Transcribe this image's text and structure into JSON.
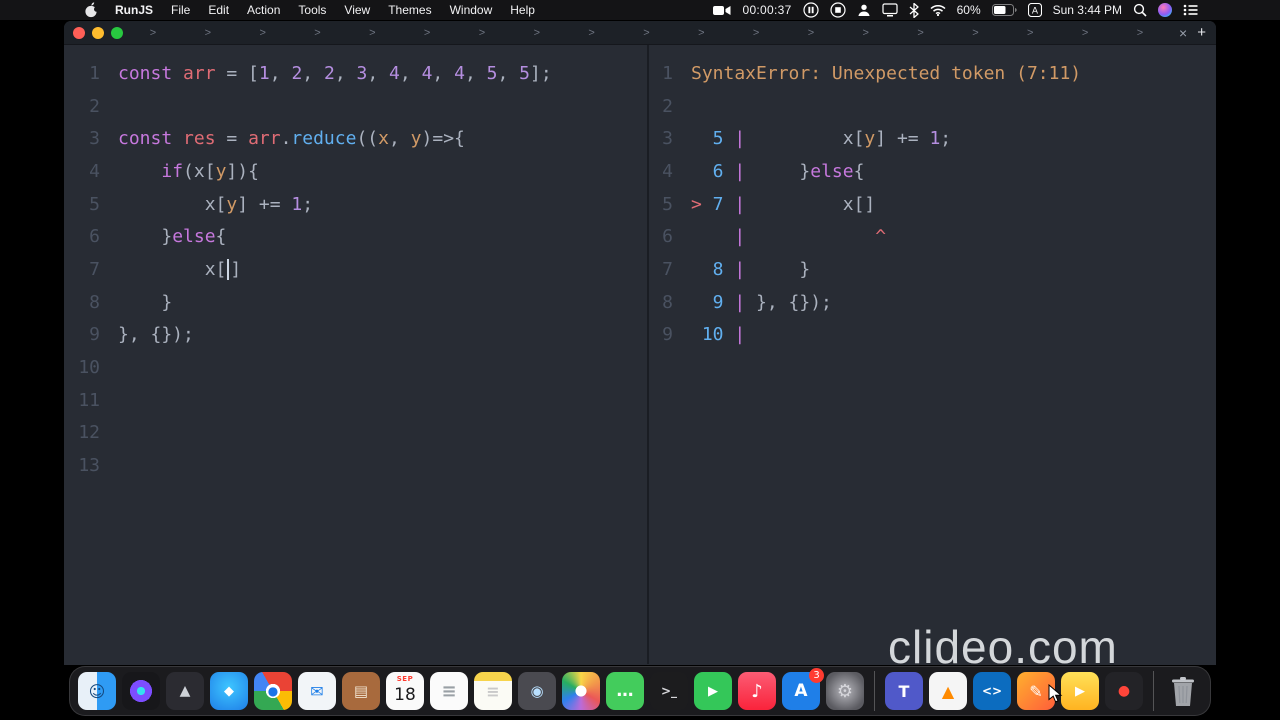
{
  "menu_bar": {
    "items": [
      "RunJS",
      "File",
      "Edit",
      "Action",
      "Tools",
      "View",
      "Themes",
      "Window",
      "Help"
    ],
    "recording_time": "00:00:37",
    "battery": "60%",
    "clock": "Sun 3:44 PM"
  },
  "window": {
    "tab_chevrons": [
      ">",
      ">",
      ">",
      ">",
      ">",
      ">",
      ">",
      ">",
      ">",
      ">",
      ">",
      ">",
      ">",
      ">",
      ">",
      ">",
      ">",
      ">",
      ">"
    ],
    "tab_close": "×",
    "new_tab": "+"
  },
  "editor": {
    "lines": [
      {
        "n": "1",
        "s": [
          {
            "c": "kw",
            "t": "const"
          },
          {
            "c": "d",
            "t": " "
          },
          {
            "c": "v",
            "t": "arr"
          },
          {
            "c": "d",
            "t": " = ["
          },
          {
            "c": "n",
            "t": "1"
          },
          {
            "c": "d",
            "t": ", "
          },
          {
            "c": "n",
            "t": "2"
          },
          {
            "c": "d",
            "t": ", "
          },
          {
            "c": "n",
            "t": "2"
          },
          {
            "c": "d",
            "t": ", "
          },
          {
            "c": "n",
            "t": "3"
          },
          {
            "c": "d",
            "t": ", "
          },
          {
            "c": "n",
            "t": "4"
          },
          {
            "c": "d",
            "t": ", "
          },
          {
            "c": "n",
            "t": "4"
          },
          {
            "c": "d",
            "t": ", "
          },
          {
            "c": "n",
            "t": "4"
          },
          {
            "c": "d",
            "t": ", "
          },
          {
            "c": "n",
            "t": "5"
          },
          {
            "c": "d",
            "t": ", "
          },
          {
            "c": "n",
            "t": "5"
          },
          {
            "c": "d",
            "t": "];"
          }
        ]
      },
      {
        "n": "2",
        "s": []
      },
      {
        "n": "3",
        "s": [
          {
            "c": "kw",
            "t": "const"
          },
          {
            "c": "d",
            "t": " "
          },
          {
            "c": "v",
            "t": "res"
          },
          {
            "c": "d",
            "t": " = "
          },
          {
            "c": "v",
            "t": "arr"
          },
          {
            "c": "d",
            "t": "."
          },
          {
            "c": "f",
            "t": "reduce"
          },
          {
            "c": "d",
            "t": "(("
          },
          {
            "c": "p",
            "t": "x"
          },
          {
            "c": "d",
            "t": ", "
          },
          {
            "c": "p",
            "t": "y"
          },
          {
            "c": "d",
            "t": ")=>{"
          }
        ]
      },
      {
        "n": "4",
        "s": [
          {
            "c": "d",
            "t": "    "
          },
          {
            "c": "kw",
            "t": "if"
          },
          {
            "c": "d",
            "t": "(x["
          },
          {
            "c": "p",
            "t": "y"
          },
          {
            "c": "d",
            "t": "]){"
          }
        ]
      },
      {
        "n": "5",
        "s": [
          {
            "c": "d",
            "t": "        x["
          },
          {
            "c": "p",
            "t": "y"
          },
          {
            "c": "d",
            "t": "] += "
          },
          {
            "c": "n",
            "t": "1"
          },
          {
            "c": "d",
            "t": ";"
          }
        ]
      },
      {
        "n": "6",
        "s": [
          {
            "c": "d",
            "t": "    }"
          },
          {
            "c": "kw",
            "t": "else"
          },
          {
            "c": "d",
            "t": "{"
          }
        ]
      },
      {
        "n": "7",
        "s": [
          {
            "c": "d",
            "t": "        x["
          },
          {
            "c": "caret",
            "t": ""
          },
          {
            "c": "d",
            "t": "]"
          }
        ]
      },
      {
        "n": "8",
        "s": [
          {
            "c": "d",
            "t": "    }"
          }
        ]
      },
      {
        "n": "9",
        "s": [
          {
            "c": "d",
            "t": "}, {});"
          }
        ]
      },
      {
        "n": "10",
        "s": []
      },
      {
        "n": "11",
        "s": []
      },
      {
        "n": "12",
        "s": []
      },
      {
        "n": "13",
        "s": []
      }
    ]
  },
  "output": {
    "lines": [
      {
        "n": "1",
        "s": [
          {
            "c": "e",
            "t": "SyntaxError: Unexpected token (7:11)"
          }
        ]
      },
      {
        "n": "2",
        "s": []
      },
      {
        "n": "3",
        "s": [
          {
            "c": "ln",
            "t": "  5 "
          },
          {
            "c": "pp",
            "t": "|"
          },
          {
            "c": "d",
            "t": "         x["
          },
          {
            "c": "p",
            "t": "y"
          },
          {
            "c": "d",
            "t": "] += "
          },
          {
            "c": "n",
            "t": "1"
          },
          {
            "c": "d",
            "t": ";"
          }
        ]
      },
      {
        "n": "4",
        "s": [
          {
            "c": "ln",
            "t": "  6 "
          },
          {
            "c": "pp",
            "t": "|"
          },
          {
            "c": "d",
            "t": "     }"
          },
          {
            "c": "kw",
            "t": "else"
          },
          {
            "c": "d",
            "t": "{"
          }
        ]
      },
      {
        "n": "5",
        "s": [
          {
            "c": "mk",
            "t": ">"
          },
          {
            "c": "ln",
            "t": " 7 "
          },
          {
            "c": "pp",
            "t": "|"
          },
          {
            "c": "d",
            "t": "         x[]"
          }
        ]
      },
      {
        "n": "6",
        "s": [
          {
            "c": "ln",
            "t": "    "
          },
          {
            "c": "pp",
            "t": "|"
          },
          {
            "c": "d",
            "t": "            "
          },
          {
            "c": "mk",
            "t": "^"
          }
        ]
      },
      {
        "n": "7",
        "s": [
          {
            "c": "ln",
            "t": "  8 "
          },
          {
            "c": "pp",
            "t": "|"
          },
          {
            "c": "d",
            "t": "     }"
          }
        ]
      },
      {
        "n": "8",
        "s": [
          {
            "c": "ln",
            "t": "  9 "
          },
          {
            "c": "pp",
            "t": "|"
          },
          {
            "c": "d",
            "t": " }, {});"
          }
        ]
      },
      {
        "n": "9",
        "s": [
          {
            "c": "ln",
            "t": " 10 "
          },
          {
            "c": "pp",
            "t": "|"
          }
        ]
      }
    ]
  },
  "dock": {
    "apps": [
      {
        "id": "finder",
        "bg": "linear-gradient(90deg,#e8f0f8 0 50%,#2f9bf4 50%)",
        "glyph": "☺",
        "fg": "#14487f",
        "size": 16
      },
      {
        "id": "siri",
        "bg": "radial-gradient(circle,#35e0f0 0 4px,#7c4dff 4px 11px,#17171a 11px)",
        "glyph": ""
      },
      {
        "id": "launchpad",
        "bg": "#2b2b31",
        "glyph": "▲",
        "fg": "#cfd2d8",
        "size": 14
      },
      {
        "id": "safari",
        "bg": "radial-gradient(circle at 50% 40%,#3ec6ff,#1f7fe8)",
        "glyph": "◆",
        "fg": "#ffffff",
        "size": 13
      },
      {
        "id": "chrome",
        "bg": "radial-gradient(circle,#ffffff 26%,transparent 27%), conic-gradient(from -30deg,#ea4335 0 120deg,#fbbc05 120deg 180deg,#34a853 180deg 300deg,#4285f4 300deg 360deg)",
        "glyph": "●",
        "fg": "#1a73e8",
        "size": 12
      },
      {
        "id": "mail",
        "bg": "#f2f5f8",
        "glyph": "✉",
        "fg": "#1f7fe8",
        "size": 16
      },
      {
        "id": "books",
        "bg": "#a86a3d",
        "glyph": "▤",
        "fg": "#f1e3cf",
        "size": 15
      },
      {
        "id": "calendar",
        "bg": "#fafafa",
        "glyph": "18",
        "top": "SEP"
      },
      {
        "id": "textedit",
        "bg": "#fbfbfb",
        "glyph": "≡",
        "fg": "#9aa0a6",
        "size": 18
      },
      {
        "id": "notes",
        "bg": "linear-gradient(180deg,#f7d44c 0 9px,#fbfbf5 9px)",
        "glyph": "≡",
        "fg": "#c9c9c9",
        "size": 16
      },
      {
        "id": "photo-booth",
        "bg": "#4a4a50",
        "glyph": "◉",
        "fg": "#b9e0ff",
        "size": 15
      },
      {
        "id": "photos",
        "bg": "radial-gradient(circle,#ffffff 20%,transparent 21%), conic-gradient(#f8d648,#f2994a,#eb5757,#bb6bd9,#2f80ed,#27ae60,#f8d648)",
        "glyph": ""
      },
      {
        "id": "messages",
        "bg": "#43cc5c",
        "glyph": "…",
        "fg": "#ffffff",
        "size": 17
      },
      {
        "id": "terminal",
        "bg": "#1c1c1e",
        "glyph": ">_",
        "fg": "#d8d8dc",
        "size": 12
      },
      {
        "id": "facetime",
        "bg": "#34c759",
        "glyph": "▶",
        "fg": "#ffffff",
        "size": 13
      },
      {
        "id": "music",
        "bg": "linear-gradient(180deg,#fb5c74,#fa233b)",
        "glyph": "♪",
        "fg": "#ffffff",
        "size": 18
      },
      {
        "id": "app-store",
        "bg": "#1f7fe8",
        "glyph": "A",
        "fg": "#ffffff",
        "size": 17,
        "badge": "3"
      },
      {
        "id": "system-preferences",
        "bg": "radial-gradient(circle,#9a9aa0 25%,#5b5b61 75%)",
        "glyph": "⚙",
        "fg": "#d6d6db",
        "size": 18
      },
      {
        "divider": true
      },
      {
        "id": "teams",
        "bg": "#5059c9",
        "glyph": "T",
        "fg": "#ffffff",
        "size": 16
      },
      {
        "id": "vlc",
        "bg": "#f5f5f5",
        "glyph": "▲",
        "fg": "#ff8a00",
        "size": 16
      },
      {
        "id": "vscode",
        "bg": "#0c6cbf",
        "glyph": "<>",
        "fg": "#ffffff",
        "size": 12
      },
      {
        "id": "pencil-app",
        "bg": "linear-gradient(135deg,#ffb02e,#ff5e3a)",
        "glyph": "✎",
        "fg": "#ffffff",
        "size": 16
      },
      {
        "id": "runjs",
        "bg": "linear-gradient(180deg,#ffe158,#ffb321)",
        "glyph": "▶",
        "fg": "#ffffff",
        "size": 13
      },
      {
        "id": "screen-recorder",
        "bg": "#232327",
        "glyph": "●",
        "fg": "#ff453a",
        "size": 14
      },
      {
        "divider": true
      }
    ]
  },
  "watermark": {
    "text": "clideo.com"
  },
  "colors": {
    "editor_bg": "#282c34",
    "titlebar_bg": "#1d2127",
    "menubar_bg": "#141416",
    "keyword": "#c678dd",
    "variable": "#e06c75",
    "function": "#61afef",
    "param": "#d19a66",
    "number": "#b58ee0",
    "default_text": "#abb2bf",
    "error_text": "#d19a66",
    "frame_lineno": "#61afef",
    "frame_pipe": "#c678dd",
    "frame_marker": "#e06c75",
    "gutter": "#4a5261",
    "traffic_red": "#ff5f57",
    "traffic_yellow": "#febc2e",
    "traffic_green": "#28c840",
    "badge_red": "#ff3b30"
  }
}
